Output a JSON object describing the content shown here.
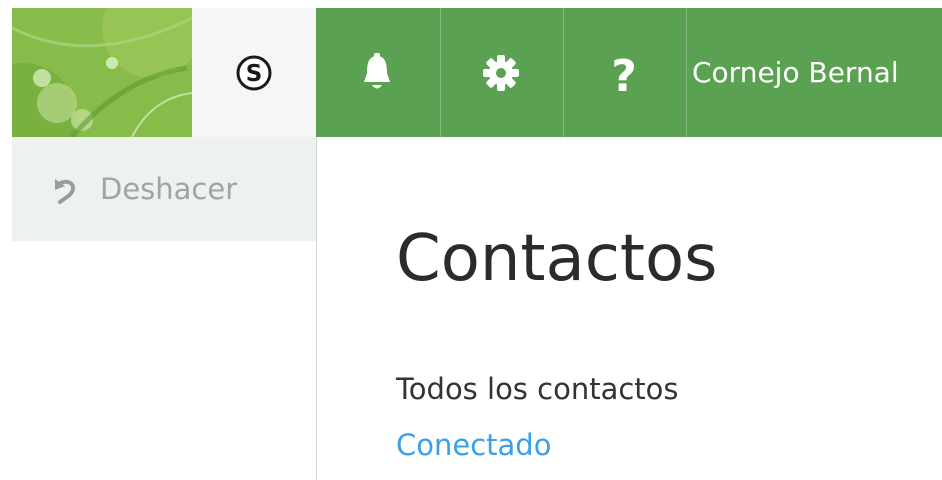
{
  "header": {
    "user_name": "Cornejo Bernal",
    "accent_color": "#5ba152",
    "icons": [
      "skype-icon",
      "bell-icon",
      "gear-icon",
      "help-icon"
    ]
  },
  "left_panel": {
    "undo_label": "Deshacer"
  },
  "main": {
    "title": "Contactos",
    "nav": [
      {
        "label": "Todos los contactos",
        "state": "selected"
      },
      {
        "label": "Conectado",
        "state": "link"
      }
    ]
  }
}
